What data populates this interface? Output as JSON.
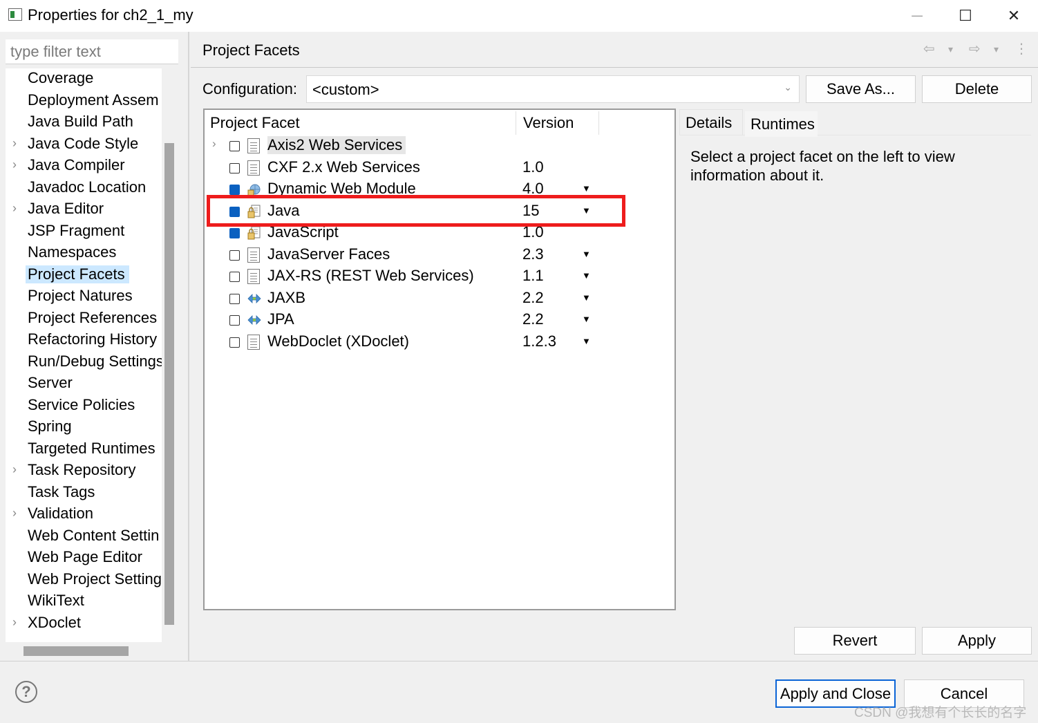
{
  "window": {
    "title": "Properties for ch2_1_my",
    "minimize": "─",
    "maximize": "☐",
    "close": "✕"
  },
  "filter": {
    "placeholder": "type filter text"
  },
  "nav": {
    "items": [
      {
        "label": "Coverage",
        "expandable": false
      },
      {
        "label": "Deployment Assem",
        "expandable": false
      },
      {
        "label": "Java Build Path",
        "expandable": false
      },
      {
        "label": "Java Code Style",
        "expandable": true
      },
      {
        "label": "Java Compiler",
        "expandable": true
      },
      {
        "label": "Javadoc Location",
        "expandable": false
      },
      {
        "label": "Java Editor",
        "expandable": true
      },
      {
        "label": "JSP Fragment",
        "expandable": false
      },
      {
        "label": "Namespaces",
        "expandable": false
      },
      {
        "label": "Project Facets",
        "expandable": false,
        "selected": true
      },
      {
        "label": "Project Natures",
        "expandable": false
      },
      {
        "label": "Project References",
        "expandable": false
      },
      {
        "label": "Refactoring History",
        "expandable": false
      },
      {
        "label": "Run/Debug Settings",
        "expandable": false
      },
      {
        "label": "Server",
        "expandable": false
      },
      {
        "label": "Service Policies",
        "expandable": false
      },
      {
        "label": "Spring",
        "expandable": false
      },
      {
        "label": "Targeted Runtimes",
        "expandable": false
      },
      {
        "label": "Task Repository",
        "expandable": true
      },
      {
        "label": "Task Tags",
        "expandable": false
      },
      {
        "label": "Validation",
        "expandable": true
      },
      {
        "label": "Web Content Settin",
        "expandable": false
      },
      {
        "label": "Web Page Editor",
        "expandable": false
      },
      {
        "label": "Web Project Setting",
        "expandable": false
      },
      {
        "label": "WikiText",
        "expandable": false
      },
      {
        "label": "XDoclet",
        "expandable": true
      }
    ]
  },
  "page": {
    "title": "Project Facets",
    "back_arrow": "⇦",
    "forward_arrow": "⇨",
    "dropdown_caret": "▾",
    "menu": "⋮"
  },
  "config": {
    "label": "Configuration:",
    "value": "<custom>",
    "save_as": "Save As...",
    "delete": "Delete"
  },
  "facets": {
    "col_facet": "Project Facet",
    "col_version": "Version",
    "rows": [
      {
        "name": "Axis2 Web Services",
        "version": "",
        "checked": false,
        "expand": true,
        "dropdown": false,
        "icon": "document-icon",
        "highlight": true
      },
      {
        "name": "CXF 2.x Web Services",
        "version": "1.0",
        "checked": false,
        "expand": false,
        "dropdown": false,
        "icon": "document-icon"
      },
      {
        "name": "Dynamic Web Module",
        "version": "4.0",
        "checked": true,
        "expand": false,
        "dropdown": true,
        "icon": "web-module-icon"
      },
      {
        "name": "Java",
        "version": "15",
        "checked": true,
        "expand": false,
        "dropdown": true,
        "icon": "java-locked-icon"
      },
      {
        "name": "JavaScript",
        "version": "1.0",
        "checked": true,
        "expand": false,
        "dropdown": false,
        "icon": "javascript-locked-icon"
      },
      {
        "name": "JavaServer Faces",
        "version": "2.3",
        "checked": false,
        "expand": false,
        "dropdown": true,
        "icon": "document-icon"
      },
      {
        "name": "JAX-RS (REST Web Services)",
        "version": "1.1",
        "checked": false,
        "expand": false,
        "dropdown": true,
        "icon": "document-icon"
      },
      {
        "name": "JAXB",
        "version": "2.2",
        "checked": false,
        "expand": false,
        "dropdown": true,
        "icon": "bidirectional-arrow-icon"
      },
      {
        "name": "JPA",
        "version": "2.2",
        "checked": false,
        "expand": false,
        "dropdown": true,
        "icon": "bidirectional-arrow-icon"
      },
      {
        "name": "WebDoclet (XDoclet)",
        "version": "1.2.3",
        "checked": false,
        "expand": false,
        "dropdown": true,
        "icon": "document-icon"
      }
    ]
  },
  "details": {
    "tab_details": "Details",
    "tab_runtimes": "Runtimes",
    "text": "Select a project facet on the left to view information about it."
  },
  "buttons": {
    "revert": "Revert",
    "apply": "Apply",
    "apply_close": "Apply and Close",
    "cancel": "Cancel",
    "help": "?"
  },
  "watermark": "CSDN @我想有个长长的名字",
  "colors": {
    "highlight_box": "#ee1c1c",
    "checkbox_checked": "#0a60c0",
    "selection": "#cce8ff"
  }
}
